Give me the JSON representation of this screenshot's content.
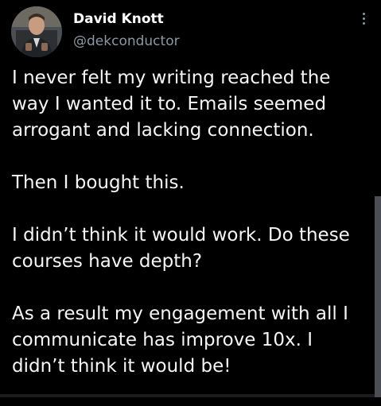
{
  "author": {
    "display_name": "David Knott",
    "handle": "@dekconductor"
  },
  "icons": {
    "more": "more-vertical-icon",
    "avatar": "profile-photo"
  },
  "tweet": {
    "paragraphs": [
      {
        "lines": [
          "I never felt my writing reached the",
          "way I wanted it to. Emails seemed",
          "arrogant and lacking connection."
        ]
      },
      {
        "lines": [
          "Then I bought this."
        ]
      },
      {
        "lines": [
          "I didn’t think it would work. Do these",
          "courses have depth?"
        ]
      },
      {
        "lines": [
          "As a result my engagement with all I",
          "communicate has improve 10x. I",
          "didn’t think it would be!"
        ]
      }
    ]
  },
  "colors": {
    "background": "#000000",
    "text": "#f5f5f5",
    "secondary_text": "#8b98a5",
    "scrollbar": "#4b4f54"
  }
}
